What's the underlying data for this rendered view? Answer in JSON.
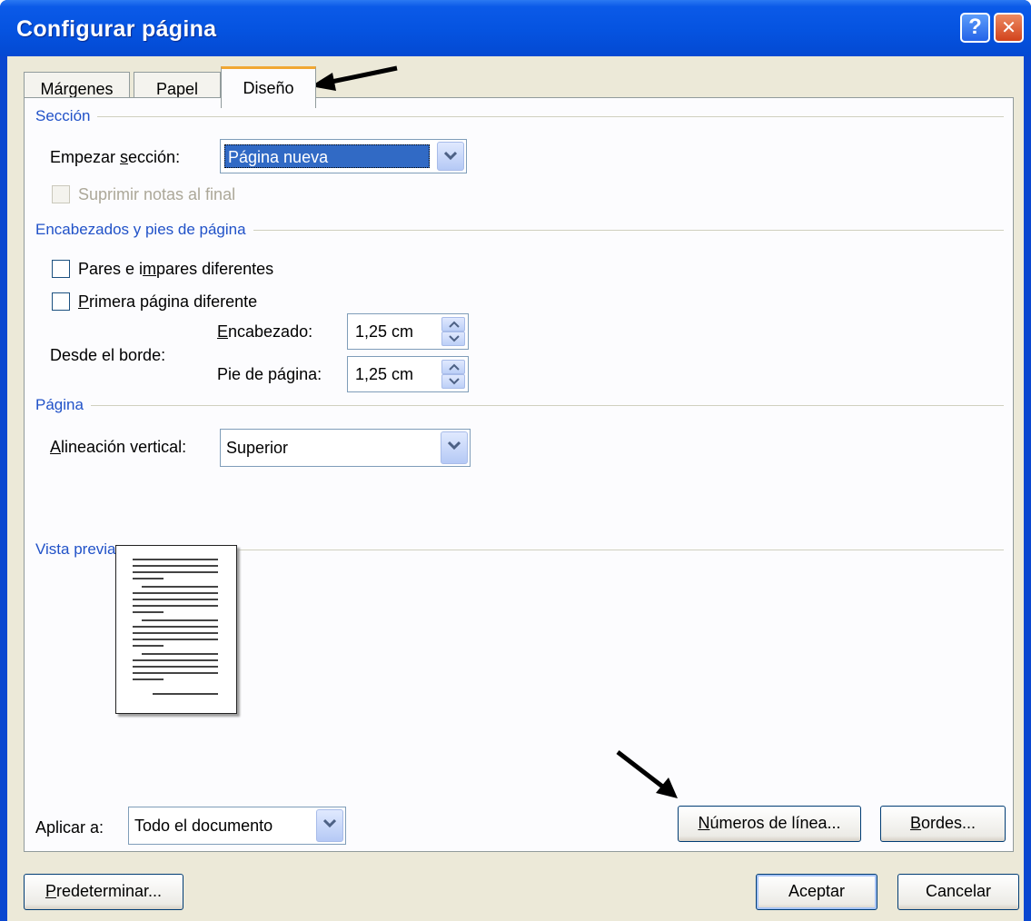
{
  "window": {
    "title": "Configurar página",
    "help_glyph": "?",
    "close_glyph": "✕"
  },
  "tabs": [
    {
      "label": "Márgenes",
      "active": false
    },
    {
      "label": "Papel",
      "active": false
    },
    {
      "label": "Diseño",
      "active": true
    }
  ],
  "seccion": {
    "heading": "Sección",
    "empezar_label_pre": "Empezar ",
    "empezar_label_u": "s",
    "empezar_label_post": "ección:",
    "empezar_value": "Página nueva",
    "suprimir_label": "Suprimir notas al final",
    "suprimir_checked": false,
    "suprimir_enabled": false
  },
  "encabezados": {
    "heading": "Encabezados y pies de página",
    "pares_pre": "Pares e i",
    "pares_u": "m",
    "pares_post": "pares diferentes",
    "pares_checked": false,
    "primera_u": "P",
    "primera_post": "rimera página diferente",
    "primera_checked": false,
    "desde_borde": "Desde el borde:",
    "encabezado_u": "E",
    "encabezado_post": "ncabezado:",
    "encabezado_value": "1,25 cm",
    "pie_pre": "Pie de pá",
    "pie_u": "g",
    "pie_post": "ina:",
    "pie_value": "1,25 cm"
  },
  "pagina": {
    "heading": "Página",
    "alineacion_u": "A",
    "alineacion_post": "lineación vertical:",
    "alineacion_value": "Superior"
  },
  "vista_previa": {
    "heading": "Vista previa"
  },
  "aplicar": {
    "label": "Aplicar a:",
    "value": "Todo el documento"
  },
  "buttons": {
    "numeros_u": "N",
    "numeros_post": "úmeros de línea...",
    "bordes_u": "B",
    "bordes_post": "ordes...",
    "predeterminar_u": "P",
    "predeterminar_post": "redeterminar...",
    "aceptar": "Aceptar",
    "cancelar": "Cancelar"
  },
  "colors": {
    "titlebar": "#0553e0",
    "section_heading": "#2152c8",
    "dialog_bg": "#ece9d8",
    "active_tab_accent": "#f1a732"
  }
}
